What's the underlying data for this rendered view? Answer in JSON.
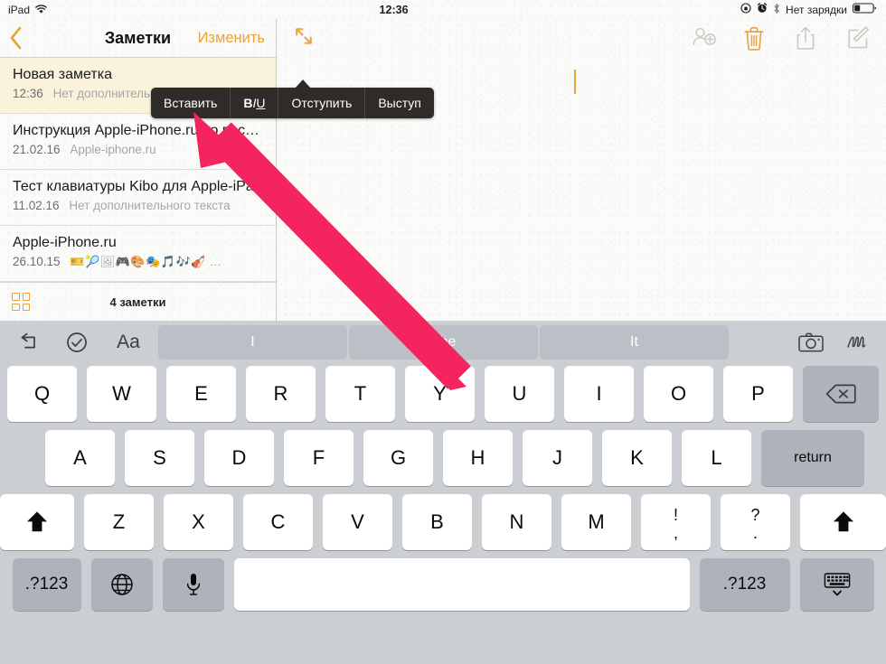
{
  "statusbar": {
    "device": "iPad",
    "wifi_icon": "wifi-icon",
    "time": "12:36",
    "rotation_lock_icon": "rotation-lock-icon",
    "alarm_icon": "alarm-clock-icon",
    "bluetooth_icon": "bluetooth-icon",
    "battery_label": "Нет зарядки",
    "battery_icon": "battery-icon"
  },
  "sidebar": {
    "back_icon": "chevron-left-icon",
    "title": "Заметки",
    "edit_label": "Изменить",
    "notes": [
      {
        "title": "Новая заметка",
        "date": "12:36",
        "snippet": "Нет дополнительного текста",
        "selected": true
      },
      {
        "title": "Инструкция Apple-iPhone.ru по восстановлению…",
        "date": "21.02.16",
        "snippet": "Apple-iphone.ru",
        "selected": false
      },
      {
        "title": "Тест клавиатуры Kibo для Apple-iPad",
        "date": "11.02.16",
        "snippet": "Нет дополнительного текста",
        "selected": false
      },
      {
        "title": "Apple-iPhone.ru",
        "date": "26.10.15",
        "snippet": "🎫🎾🖼🎮🎨🎭🎵🎶🎻 …",
        "selected": false
      }
    ],
    "footer": {
      "grid_icon": "grid-view-icon",
      "count_label": "4 заметки"
    }
  },
  "editor": {
    "expand_icon": "expand-arrows-icon",
    "tools": [
      {
        "name": "add-person-icon",
        "enabled": false
      },
      {
        "name": "trash-icon",
        "enabled": true
      },
      {
        "name": "share-icon",
        "enabled": false
      },
      {
        "name": "compose-icon",
        "enabled": false
      }
    ],
    "caret_visible": true
  },
  "context_menu": {
    "items": [
      {
        "label": "Вставить",
        "name": "paste-menu-item"
      },
      {
        "label": "BIU",
        "name": "format-biu-menu-item",
        "b": "B",
        "i": "I",
        "u": "U"
      },
      {
        "label": "Отступить",
        "name": "indent-menu-item"
      },
      {
        "label": "Выступ",
        "name": "outdent-menu-item"
      }
    ]
  },
  "keyboard": {
    "toolbar": {
      "undo_icon": "undo-icon",
      "check_icon": "checkmark-circle-icon",
      "format_label": "Aa",
      "camera_icon": "camera-icon",
      "squiggle_icon": "handwriting-icon"
    },
    "predictions": [
      "I",
      "The",
      "It"
    ],
    "row1": [
      "Q",
      "W",
      "E",
      "R",
      "T",
      "Y",
      "U",
      "I",
      "O",
      "P"
    ],
    "backspace_icon": "backspace-icon",
    "row2": [
      "A",
      "S",
      "D",
      "F",
      "G",
      "H",
      "J",
      "K",
      "L"
    ],
    "return_label": "return",
    "row3": [
      "Z",
      "X",
      "C",
      "V",
      "B",
      "N",
      "M"
    ],
    "shift_icon": "shift-icon",
    "punct1": {
      "top": "!",
      "bot": ","
    },
    "punct2": {
      "top": "?",
      "bot": "."
    },
    "row4": {
      "num_left": ".?123",
      "globe_icon": "globe-icon",
      "mic_icon": "microphone-icon",
      "space_label": "",
      "num_right": ".?123",
      "hide_icon": "hide-keyboard-icon"
    }
  },
  "annotation": {
    "arrow_color": "#f4245e",
    "arrow_name": "pointer-arrow-annotation"
  },
  "colors": {
    "accent": "#e8a33d",
    "selected_note_bg": "#faf2da",
    "keyboard_bg": "#cbced3",
    "menu_bg": "#2e2b29"
  }
}
